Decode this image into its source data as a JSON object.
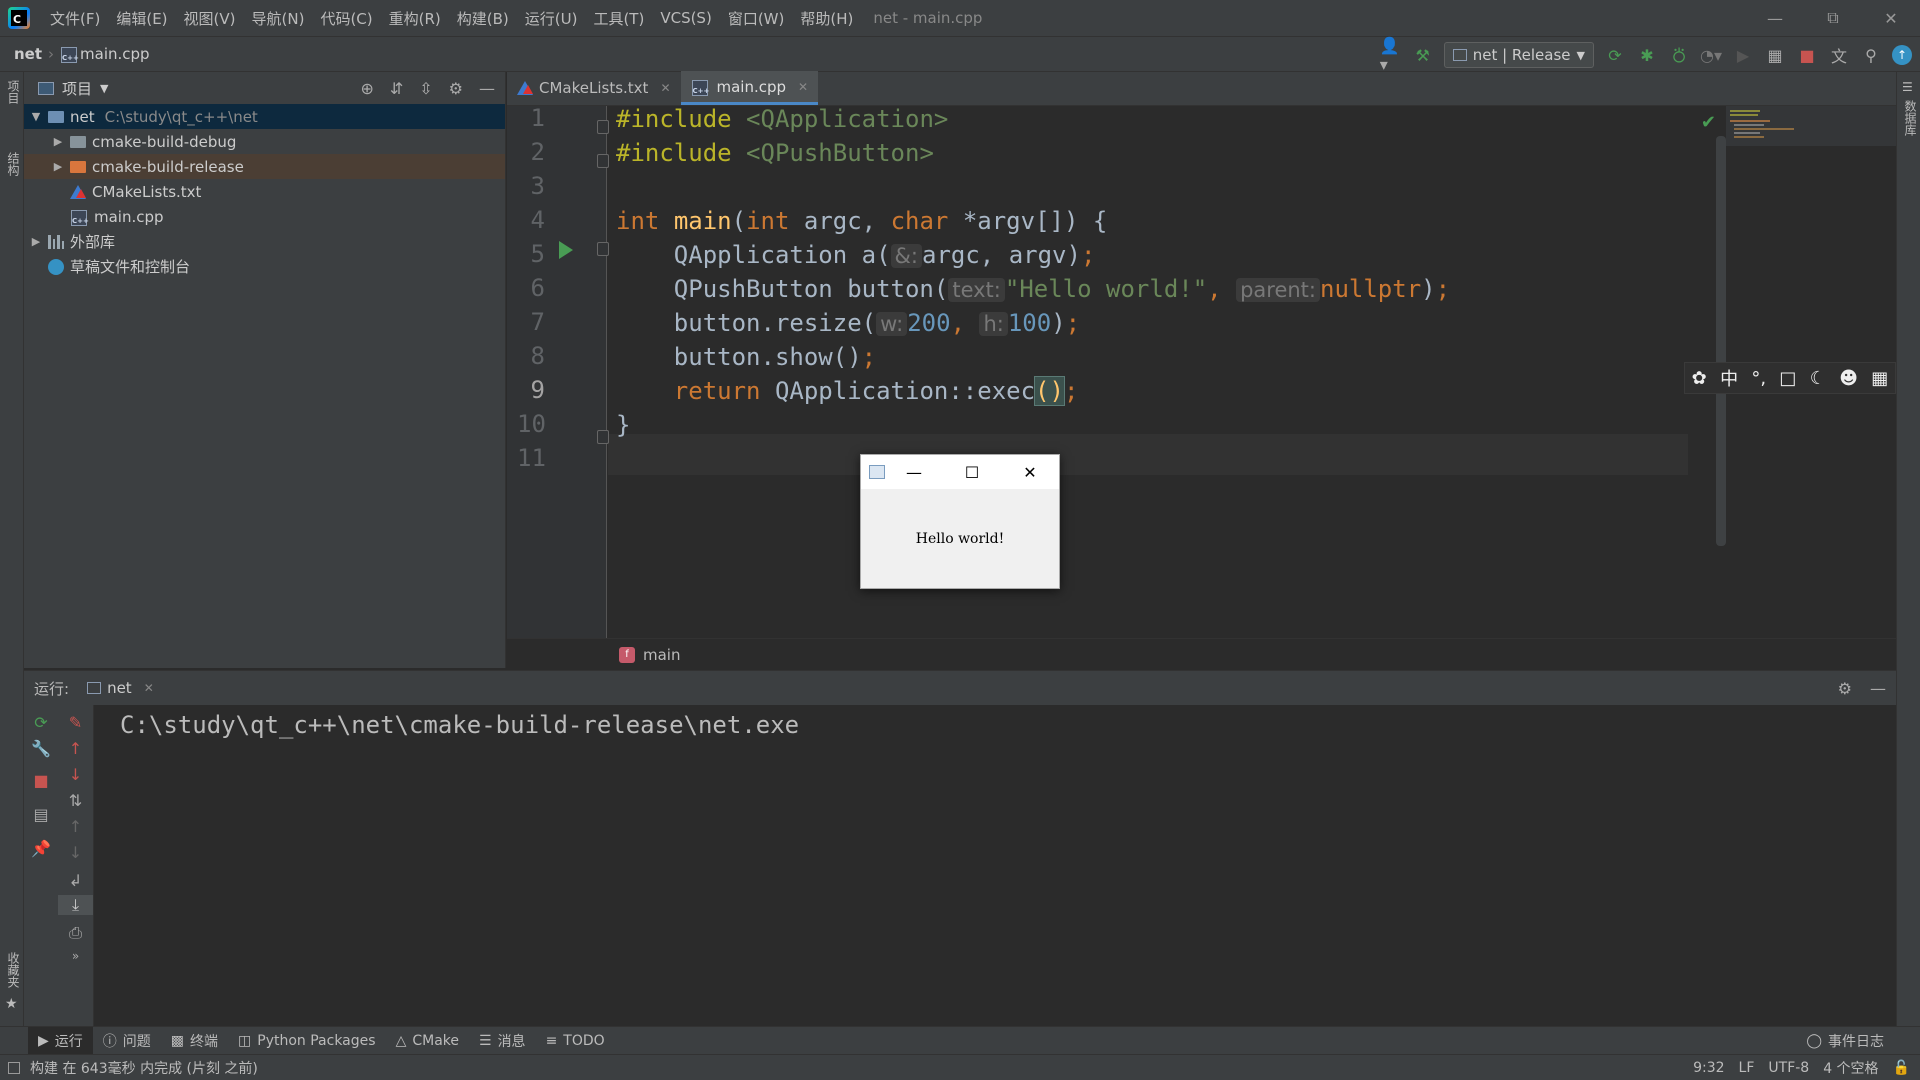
{
  "menubar": {
    "items": [
      "文件(F)",
      "编辑(E)",
      "视图(V)",
      "导航(N)",
      "代码(C)",
      "重构(R)",
      "构建(B)",
      "运行(U)",
      "工具(T)",
      "VCS(S)",
      "窗口(W)",
      "帮助(H)"
    ],
    "window_title": "net - main.cpp"
  },
  "navbar": {
    "project": "net",
    "file": "main.cpp",
    "run_config": "net | Release"
  },
  "left_strip": {
    "project_label": "项目",
    "structure_label": "结构",
    "favorites_label": "收藏夹"
  },
  "right_strip": {
    "database_label": "数据库"
  },
  "project_panel": {
    "title": "项目",
    "tree": [
      {
        "label": "net",
        "path": "C:\\study\\qt_c++\\net"
      },
      {
        "label": "cmake-build-debug"
      },
      {
        "label": "cmake-build-release"
      },
      {
        "label": "CMakeLists.txt"
      },
      {
        "label": "main.cpp"
      },
      {
        "label": "外部库"
      },
      {
        "label": "草稿文件和控制台"
      }
    ]
  },
  "editor_tabs": [
    {
      "label": "CMakeLists.txt",
      "active": false
    },
    {
      "label": "main.cpp",
      "active": true
    }
  ],
  "editor": {
    "line_numbers": [
      "1",
      "2",
      "3",
      "4",
      "5",
      "6",
      "7",
      "8",
      "9",
      "10",
      "11"
    ],
    "current_line": 9,
    "code": {
      "l1_directive": "#include",
      "l1_header": "<QApplication>",
      "l2_directive": "#include",
      "l2_header": "<QPushButton>",
      "l4_int": "int",
      "l4_main": "main",
      "l4_open": "(",
      "l4_int2": "int",
      "l4_argc": " argc, ",
      "l4_char": "char",
      "l4_rest": " *argv[]) {",
      "l5_a": "QApplication a(",
      "l5_hint": "&:",
      "l5_b": "argc, argv)",
      "l5_semi": ";",
      "l6_a": "QPushButton button(",
      "l6_hint1": "text:",
      "l6_str": "\"Hello world!\"",
      "l6_comma": ",",
      "l6_hint2": "parent:",
      "l6_null": "nullptr",
      "l6_end": ")",
      "l6_semi": ";",
      "l7_a": "button.resize(",
      "l7_hint1": "w:",
      "l7_n1": "200",
      "l7_comma": ",",
      "l7_hint2": "h:",
      "l7_n2": "100",
      "l7_end": ")",
      "l7_semi": ";",
      "l8_a": "button.show()",
      "l8_semi": ";",
      "l9_return": "return",
      "l9_a": " QApplication::exec",
      "l9_paren": "()",
      "l9_semi": ";",
      "l10": "}"
    },
    "breadcrumb_fn": "main"
  },
  "popup": {
    "text": "Hello world!"
  },
  "run_panel": {
    "label": "运行:",
    "tab": "net",
    "console_line": "C:\\study\\qt_c++\\net\\cmake-build-release\\net.exe"
  },
  "tool_windows": [
    "运行",
    "问题",
    "终端",
    "Python Packages",
    "CMake",
    "消息",
    "TODO"
  ],
  "event_log": "事件日志",
  "statusbar": {
    "message": "构建 在 643毫秒 内完成 (片刻 之前)",
    "position": "9:32",
    "line_sep": "LF",
    "encoding": "UTF-8",
    "indent": "4 个空格"
  },
  "colors": {
    "background": "#2b2b2b",
    "panel": "#3c3f41",
    "keyword": "#cc7832",
    "function": "#ffc66d",
    "string": "#6a8759",
    "number": "#6897bb",
    "run_green": "#499c54",
    "accent_blue": "#4a88c7"
  },
  "icons": [
    "app-logo",
    "user-icon",
    "hammer-icon",
    "rerun-icon",
    "debug-icon",
    "coverage-icon",
    "profile-icon",
    "run-icon",
    "attach-icon",
    "stop-icon",
    "translate-icon",
    "search-icon",
    "update-icon"
  ]
}
